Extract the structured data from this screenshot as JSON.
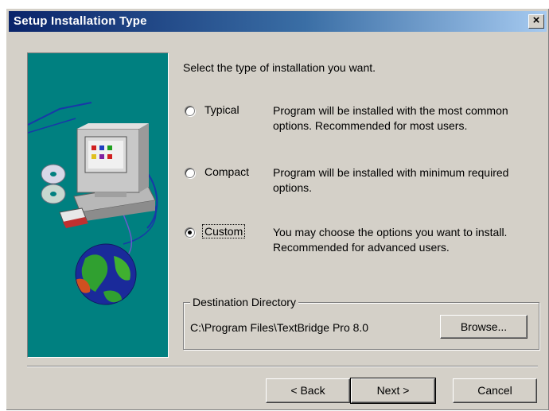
{
  "window": {
    "title": "Setup Installation Type",
    "close_label": "×"
  },
  "prompt": "Select the type of installation you want.",
  "options": [
    {
      "label": "Typical",
      "description": "Program will be installed with the most common options. Recommended for most users.",
      "selected": false
    },
    {
      "label": "Compact",
      "description": "Program will be installed with minimum required options.",
      "selected": false
    },
    {
      "label": "Custom",
      "description": "You may choose the options you want to install. Recommended for advanced users.",
      "selected": true
    }
  ],
  "destination": {
    "legend": "Destination Directory",
    "path": "C:\\Program Files\\TextBridge Pro 8.0",
    "browse_label": "Browse..."
  },
  "buttons": {
    "back_label": "< Back",
    "next_label": "Next >",
    "cancel_label": "Cancel"
  },
  "icons": [
    "computer-icon",
    "cd-disc-icon",
    "floppy-disk-icon",
    "globe-icon"
  ],
  "colors": {
    "title_bar_start": "#0a246a",
    "title_bar_end": "#a6caf0",
    "art_background": "#008080",
    "dialog_face": "#d4d0c8"
  }
}
